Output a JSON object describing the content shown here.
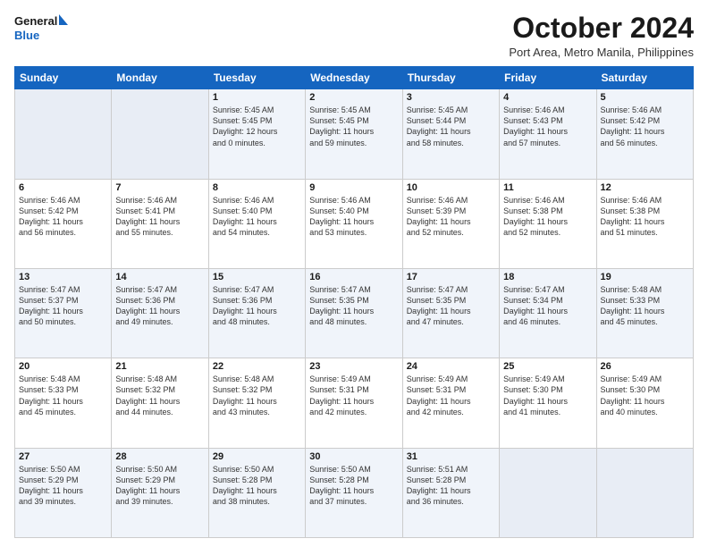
{
  "header": {
    "logo_line1": "General",
    "logo_line2": "Blue",
    "month_title": "October 2024",
    "subtitle": "Port Area, Metro Manila, Philippines"
  },
  "weekdays": [
    "Sunday",
    "Monday",
    "Tuesday",
    "Wednesday",
    "Thursday",
    "Friday",
    "Saturday"
  ],
  "weeks": [
    {
      "days": [
        {
          "num": "",
          "info": ""
        },
        {
          "num": "",
          "info": ""
        },
        {
          "num": "1",
          "info": "Sunrise: 5:45 AM\nSunset: 5:45 PM\nDaylight: 12 hours\nand 0 minutes."
        },
        {
          "num": "2",
          "info": "Sunrise: 5:45 AM\nSunset: 5:45 PM\nDaylight: 11 hours\nand 59 minutes."
        },
        {
          "num": "3",
          "info": "Sunrise: 5:45 AM\nSunset: 5:44 PM\nDaylight: 11 hours\nand 58 minutes."
        },
        {
          "num": "4",
          "info": "Sunrise: 5:46 AM\nSunset: 5:43 PM\nDaylight: 11 hours\nand 57 minutes."
        },
        {
          "num": "5",
          "info": "Sunrise: 5:46 AM\nSunset: 5:42 PM\nDaylight: 11 hours\nand 56 minutes."
        }
      ]
    },
    {
      "days": [
        {
          "num": "6",
          "info": "Sunrise: 5:46 AM\nSunset: 5:42 PM\nDaylight: 11 hours\nand 56 minutes."
        },
        {
          "num": "7",
          "info": "Sunrise: 5:46 AM\nSunset: 5:41 PM\nDaylight: 11 hours\nand 55 minutes."
        },
        {
          "num": "8",
          "info": "Sunrise: 5:46 AM\nSunset: 5:40 PM\nDaylight: 11 hours\nand 54 minutes."
        },
        {
          "num": "9",
          "info": "Sunrise: 5:46 AM\nSunset: 5:40 PM\nDaylight: 11 hours\nand 53 minutes."
        },
        {
          "num": "10",
          "info": "Sunrise: 5:46 AM\nSunset: 5:39 PM\nDaylight: 11 hours\nand 52 minutes."
        },
        {
          "num": "11",
          "info": "Sunrise: 5:46 AM\nSunset: 5:38 PM\nDaylight: 11 hours\nand 52 minutes."
        },
        {
          "num": "12",
          "info": "Sunrise: 5:46 AM\nSunset: 5:38 PM\nDaylight: 11 hours\nand 51 minutes."
        }
      ]
    },
    {
      "days": [
        {
          "num": "13",
          "info": "Sunrise: 5:47 AM\nSunset: 5:37 PM\nDaylight: 11 hours\nand 50 minutes."
        },
        {
          "num": "14",
          "info": "Sunrise: 5:47 AM\nSunset: 5:36 PM\nDaylight: 11 hours\nand 49 minutes."
        },
        {
          "num": "15",
          "info": "Sunrise: 5:47 AM\nSunset: 5:36 PM\nDaylight: 11 hours\nand 48 minutes."
        },
        {
          "num": "16",
          "info": "Sunrise: 5:47 AM\nSunset: 5:35 PM\nDaylight: 11 hours\nand 48 minutes."
        },
        {
          "num": "17",
          "info": "Sunrise: 5:47 AM\nSunset: 5:35 PM\nDaylight: 11 hours\nand 47 minutes."
        },
        {
          "num": "18",
          "info": "Sunrise: 5:47 AM\nSunset: 5:34 PM\nDaylight: 11 hours\nand 46 minutes."
        },
        {
          "num": "19",
          "info": "Sunrise: 5:48 AM\nSunset: 5:33 PM\nDaylight: 11 hours\nand 45 minutes."
        }
      ]
    },
    {
      "days": [
        {
          "num": "20",
          "info": "Sunrise: 5:48 AM\nSunset: 5:33 PM\nDaylight: 11 hours\nand 45 minutes."
        },
        {
          "num": "21",
          "info": "Sunrise: 5:48 AM\nSunset: 5:32 PM\nDaylight: 11 hours\nand 44 minutes."
        },
        {
          "num": "22",
          "info": "Sunrise: 5:48 AM\nSunset: 5:32 PM\nDaylight: 11 hours\nand 43 minutes."
        },
        {
          "num": "23",
          "info": "Sunrise: 5:49 AM\nSunset: 5:31 PM\nDaylight: 11 hours\nand 42 minutes."
        },
        {
          "num": "24",
          "info": "Sunrise: 5:49 AM\nSunset: 5:31 PM\nDaylight: 11 hours\nand 42 minutes."
        },
        {
          "num": "25",
          "info": "Sunrise: 5:49 AM\nSunset: 5:30 PM\nDaylight: 11 hours\nand 41 minutes."
        },
        {
          "num": "26",
          "info": "Sunrise: 5:49 AM\nSunset: 5:30 PM\nDaylight: 11 hours\nand 40 minutes."
        }
      ]
    },
    {
      "days": [
        {
          "num": "27",
          "info": "Sunrise: 5:50 AM\nSunset: 5:29 PM\nDaylight: 11 hours\nand 39 minutes."
        },
        {
          "num": "28",
          "info": "Sunrise: 5:50 AM\nSunset: 5:29 PM\nDaylight: 11 hours\nand 39 minutes."
        },
        {
          "num": "29",
          "info": "Sunrise: 5:50 AM\nSunset: 5:28 PM\nDaylight: 11 hours\nand 38 minutes."
        },
        {
          "num": "30",
          "info": "Sunrise: 5:50 AM\nSunset: 5:28 PM\nDaylight: 11 hours\nand 37 minutes."
        },
        {
          "num": "31",
          "info": "Sunrise: 5:51 AM\nSunset: 5:28 PM\nDaylight: 11 hours\nand 36 minutes."
        },
        {
          "num": "",
          "info": ""
        },
        {
          "num": "",
          "info": ""
        }
      ]
    }
  ]
}
